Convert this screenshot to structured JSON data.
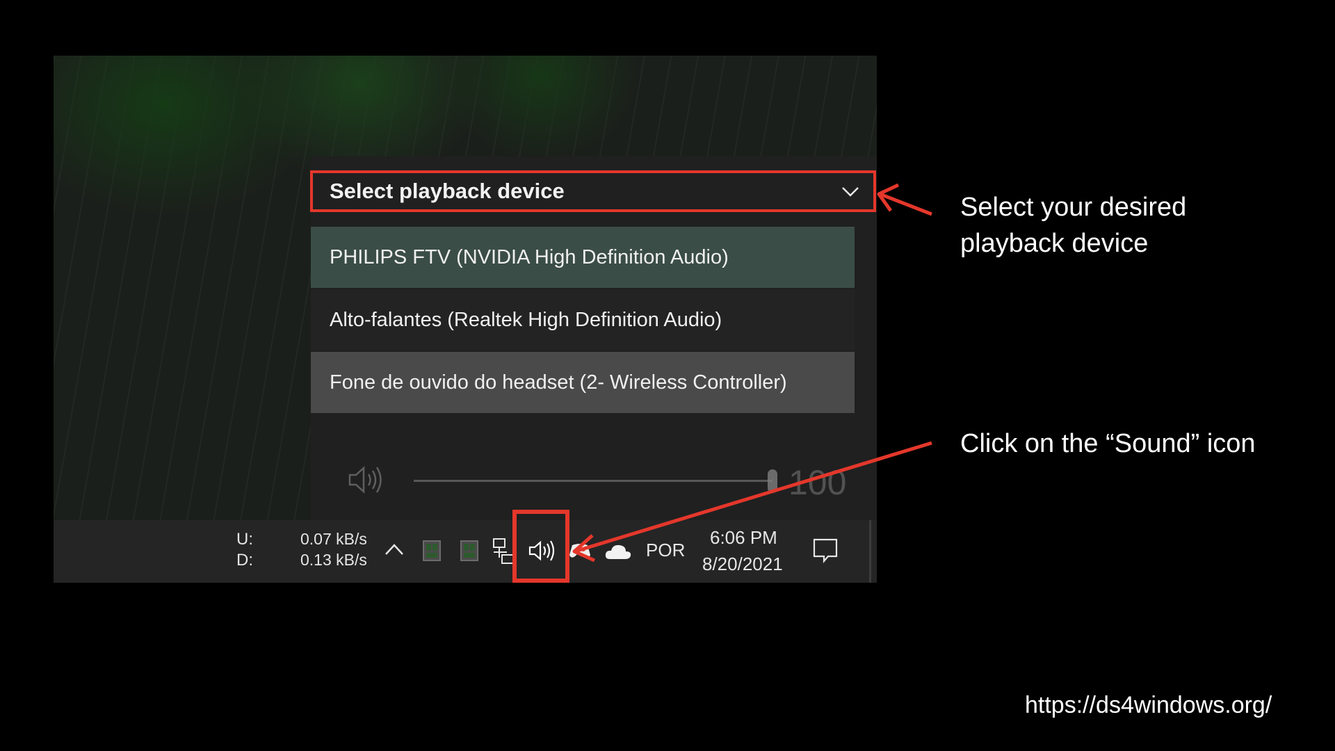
{
  "flyout": {
    "header": "Select playback device",
    "devices": [
      "PHILIPS FTV (NVIDIA High Definition Audio)",
      "Alto-falantes (Realtek High Definition Audio)",
      "Fone de ouvido do headset (2- Wireless Controller)"
    ],
    "selected_index": 0,
    "hovered_index": 2,
    "volume": "100",
    "volume_level": 1.0
  },
  "taskbar": {
    "net_up_label": "U:",
    "net_down_label": "D:",
    "net_up_speed": "0.07 kB/s",
    "net_down_speed": "0.13 kB/s",
    "language": "POR",
    "time": "6:06 PM",
    "date": "8/20/2021",
    "icons": [
      "chevron-up-icon",
      "app-tray-icon",
      "app-tray-icon",
      "network-icon",
      "speaker-icon",
      "controller-icon",
      "onedrive-cloud-icon",
      "notification-icon"
    ]
  },
  "annotations": {
    "select_device": "Select your desired playback device",
    "click_sound": "Click on the “Sound” icon",
    "accent_color": "#e4372b"
  },
  "footer": {
    "url": "https://ds4windows.org/"
  }
}
